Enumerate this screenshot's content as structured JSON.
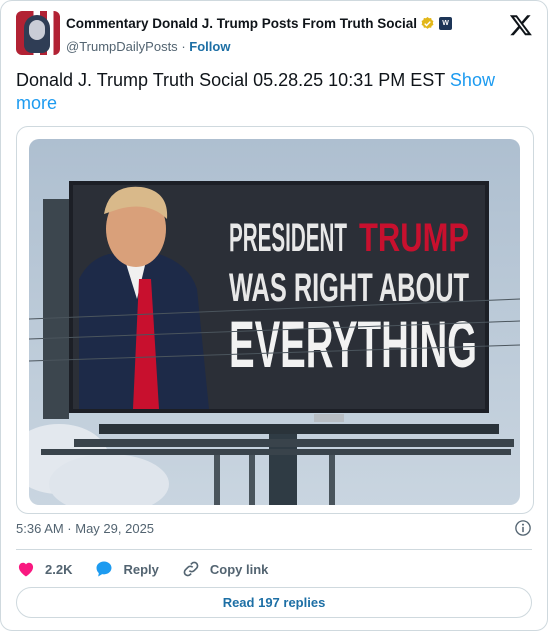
{
  "account": {
    "name": "Commentary Donald J. Trump Posts From Truth Social",
    "handle": "@TrumpDailyPosts",
    "separator": "·",
    "follow_label": "Follow",
    "affiliate_badge_text": "W"
  },
  "tweet": {
    "text": "Donald J. Trump Truth Social 05.28.25 10:31 PM EST",
    "show_more_label": "Show more",
    "timestamp": "5:36 AM · May 29, 2025"
  },
  "billboard": {
    "line1_a": "PRESIDENT",
    "line1_b": "TRUMP",
    "line2": "WAS RIGHT ABOUT",
    "line3": "EVERYTHING"
  },
  "actions": {
    "likes": "2.2K",
    "reply_label": "Reply",
    "copy_link_label": "Copy link"
  },
  "read_replies_label": "Read 197 replies",
  "colors": {
    "accent": "#1d9bf0",
    "like": "#f91880",
    "follow": "#1d6fa5",
    "billboard_red": "#c8102e"
  }
}
